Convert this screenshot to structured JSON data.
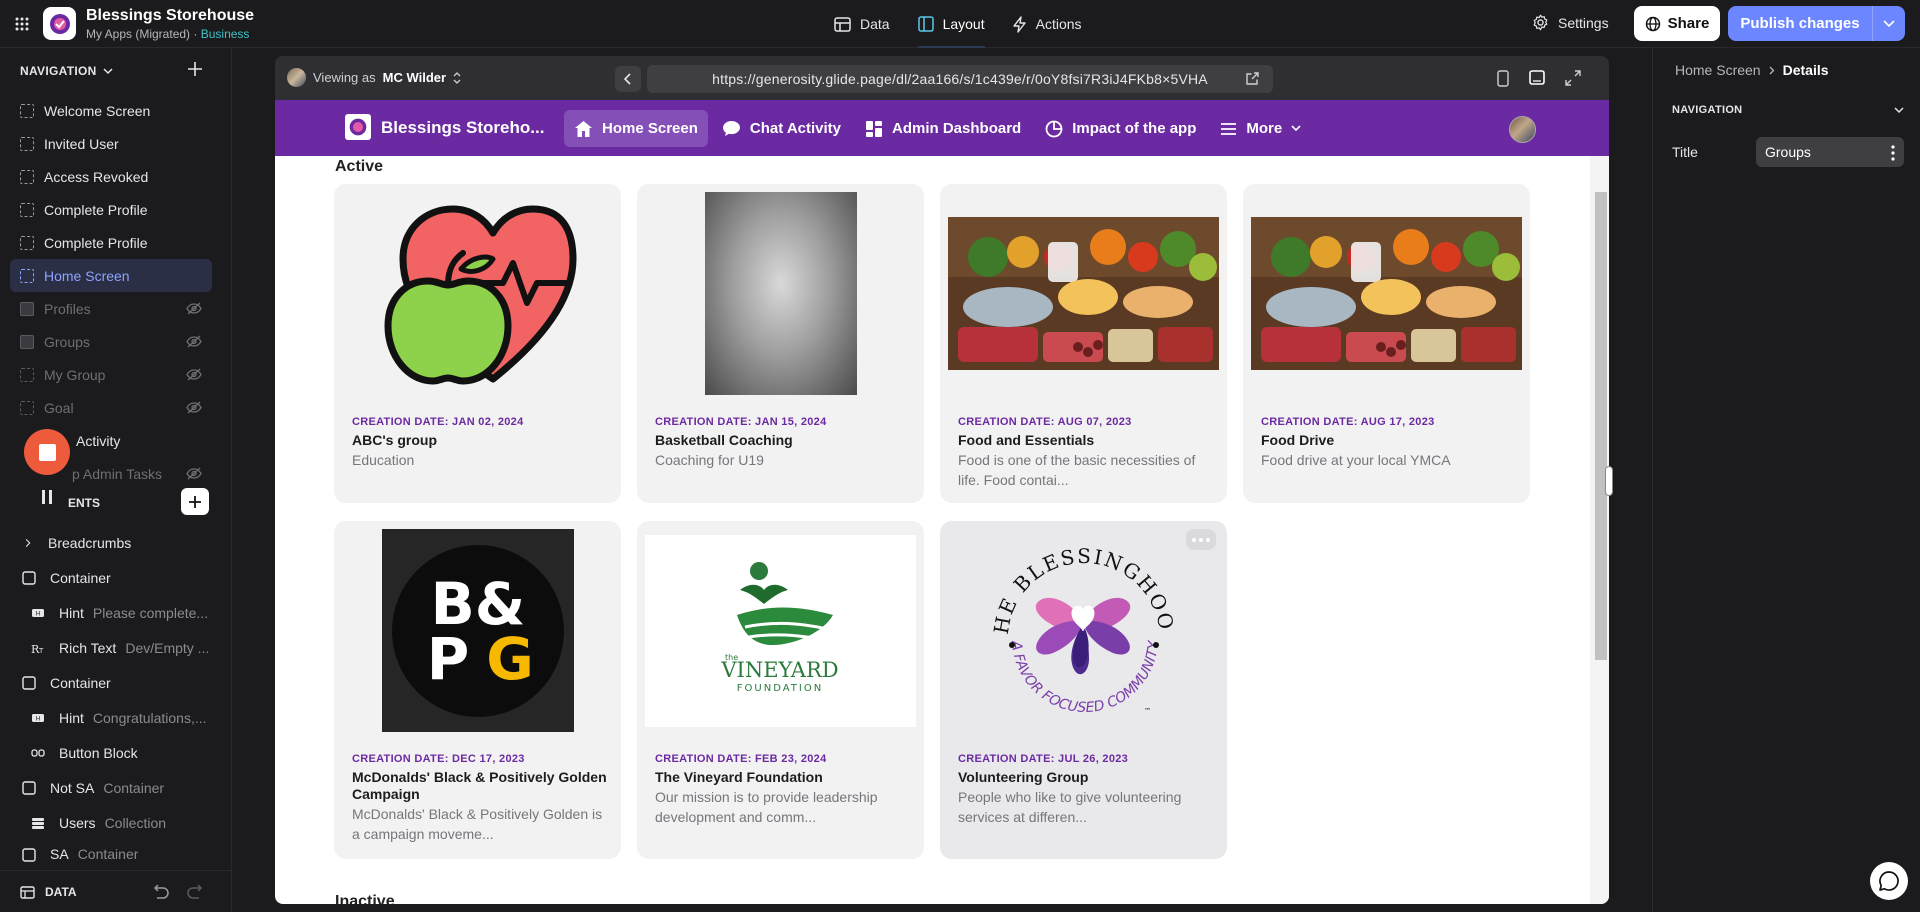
{
  "app": {
    "name": "Blessings Storehouse",
    "breadcrumb": "My Apps (Migrated)",
    "separator": " · ",
    "plan": "Business"
  },
  "topnav": {
    "tabs": [
      {
        "label": "Data",
        "icon": "table-icon"
      },
      {
        "label": "Layout",
        "icon": "layout-icon",
        "active": true
      },
      {
        "label": "Actions",
        "icon": "lightning-icon"
      }
    ]
  },
  "toolbar": {
    "settings": "Settings",
    "share": "Share",
    "publish": "Publish changes"
  },
  "sidebar": {
    "nav_header": "NAVIGATION",
    "screens": [
      {
        "label": "Welcome Screen",
        "hidden": false
      },
      {
        "label": "Invited User",
        "hidden": false
      },
      {
        "label": "Access Revoked",
        "hidden": false
      },
      {
        "label": "Complete Profile",
        "hidden": false
      },
      {
        "label": "Complete Profile",
        "hidden": false
      },
      {
        "label": "Home Screen",
        "hidden": false,
        "selected": true
      },
      {
        "label": "Profiles",
        "hidden": true
      },
      {
        "label": "Groups",
        "hidden": true
      },
      {
        "label": "My Group",
        "hidden": true
      },
      {
        "label": "Goal",
        "hidden": true
      },
      {
        "label": "Activity",
        "hidden": false
      },
      {
        "label": "p Admin Tasks",
        "hidden": true
      }
    ],
    "components_header": "ENTS",
    "components": [
      {
        "label": "Breadcrumbs",
        "sub": "",
        "level": 1,
        "icon": "chevron-right-icon"
      },
      {
        "label": "Container",
        "sub": "",
        "level": 1,
        "icon": "container-icon"
      },
      {
        "label": "Hint",
        "sub": "Please complete...",
        "level": 2,
        "icon": "hint-icon"
      },
      {
        "label": "Rich Text",
        "sub": "Dev/Empty ...",
        "level": 2,
        "icon": "rich-text-icon"
      },
      {
        "label": "Container",
        "sub": "",
        "level": 1,
        "icon": "container-icon"
      },
      {
        "label": "Hint",
        "sub": "Congratulations,...",
        "level": 2,
        "icon": "hint-icon"
      },
      {
        "label": "Button Block",
        "sub": "",
        "level": 2,
        "icon": "button-block-icon"
      },
      {
        "label": "Not SA",
        "sub": "Container",
        "level": 1,
        "icon": "container-icon"
      },
      {
        "label": "Users",
        "sub": "Collection",
        "level": 2,
        "icon": "collection-icon"
      },
      {
        "label": "SA",
        "sub": "Container",
        "level": 1,
        "icon": "container-icon"
      }
    ],
    "data_label": "DATA"
  },
  "preview": {
    "viewing_prefix": "Viewing as",
    "viewing_user": "MC Wilder",
    "url": "https://generosity.glide.page/dl/2aa166/s/1c439e/r/0oY8fsi7R3iJ4FKb8×5VHA"
  },
  "appnav": {
    "title": "Blessings Storeho...",
    "items": [
      {
        "label": "Home Screen",
        "icon": "home-icon",
        "active": true
      },
      {
        "label": "Chat Activity",
        "icon": "chat-icon"
      },
      {
        "label": "Admin Dashboard",
        "icon": "dashboard-icon"
      },
      {
        "label": "Impact of the app",
        "icon": "pie-chart-icon"
      },
      {
        "label": "More",
        "icon": "menu-icon"
      }
    ]
  },
  "sections": {
    "active": "Active",
    "inactive": "Inactive"
  },
  "cards": [
    {
      "date": "CREATION DATE: JAN 02, 2024",
      "title": "ABC's group",
      "subtitle": "Education",
      "image": "heart-apple-icon"
    },
    {
      "date": "CREATION DATE: JAN 15, 2024",
      "title": "Basketball Coaching",
      "subtitle": "Coaching for U19",
      "image": "gray-placeholder"
    },
    {
      "date": "CREATION DATE: AUG 07, 2023",
      "title": "Food and Essentials",
      "subtitle": "Food is one of the basic necessities of life. Food contai...",
      "image": "groceries-photo"
    },
    {
      "date": "CREATION DATE: AUG 17, 2023",
      "title": "Food Drive",
      "subtitle": "Food drive at your local YMCA",
      "image": "groceries-photo"
    },
    {
      "date": "CREATION DATE: DEC 17, 2023",
      "title": "McDonalds' Black & Positively Golden Campaign",
      "subtitle": "McDonalds' Black & Positively Golden is a campaign moveme...",
      "image": "bpg-logo"
    },
    {
      "date": "CREATION DATE: FEB 23, 2024",
      "title": "The Vineyard Foundation",
      "subtitle": "Our mission is to provide leadership development and comm...",
      "image": "vineyard-logo"
    },
    {
      "date": "CREATION DATE: JUL 26, 2023",
      "title": "Volunteering Group",
      "subtitle": "People who like to give volunteering services at differen...",
      "image": "blessinghood-logo"
    }
  ],
  "logos": {
    "bpg_top": "B&",
    "bpg_bottom_p": "P",
    "bpg_bottom_g": "G",
    "vineyard_the": "the",
    "vineyard_name": "VINEYARD",
    "vineyard_sub": "FOUNDATION",
    "blessinghood_top": "THE BLESSINGHOOD",
    "blessinghood_bottom": "A FAVOR FOCUSED COMMUNITY",
    "blessinghood_tm": "™"
  },
  "inspector": {
    "crumb_parent": "Home Screen",
    "crumb_current": "Details",
    "section": "NAVIGATION",
    "title_label": "Title",
    "title_value": "Groups"
  },
  "colors": {
    "brand_purple": "#6c2aa2",
    "accent_blue": "#6b86ff",
    "record_red": "#ee5a3c"
  }
}
